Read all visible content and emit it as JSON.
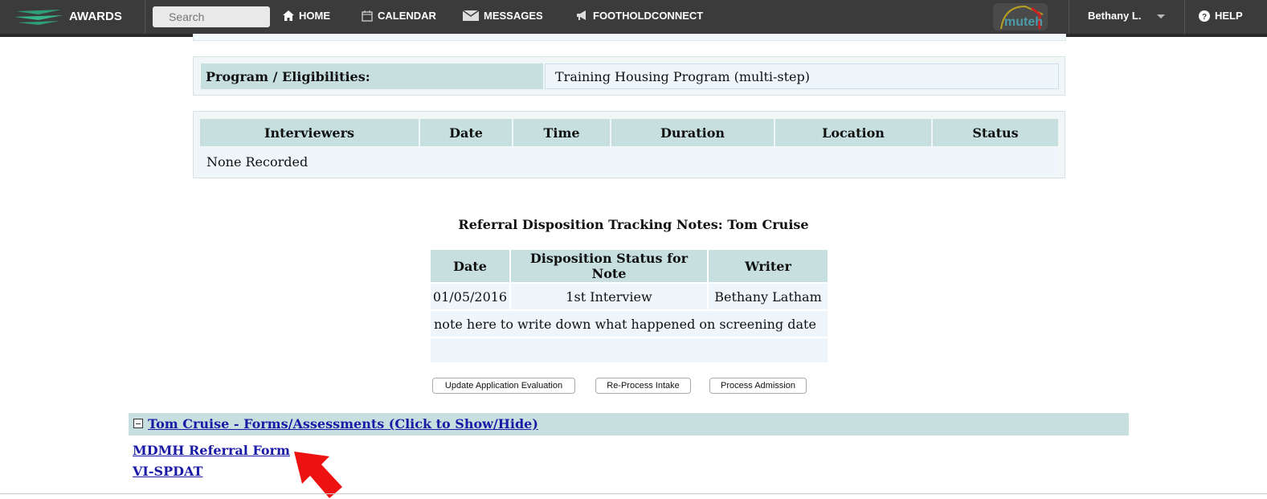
{
  "nav": {
    "brand": "AWARDS",
    "search_placeholder": "Search",
    "home": "HOME",
    "calendar": "CALENDAR",
    "messages": "MESSAGES",
    "foothold": "FOOTHOLDCONNECT",
    "partner_logo_text": "muteh",
    "user": "Bethany L.",
    "help": "HELP"
  },
  "program": {
    "label": "Program / Eligibilities:",
    "value": "Training Housing Program (multi-step)"
  },
  "interviews": {
    "headers": [
      "Interviewers",
      "Date",
      "Time",
      "Duration",
      "Location",
      "Status"
    ],
    "empty": "None Recorded"
  },
  "notes": {
    "title": "Referral Disposition Tracking Notes: Tom Cruise",
    "headers": [
      "Date",
      "Disposition Status for Note",
      "Writer"
    ],
    "row": {
      "date": "01/05/2016",
      "status": "1st Interview",
      "writer": "Bethany Latham"
    },
    "note_text": "note here to write down what happened on screening date"
  },
  "actions": {
    "update": "Update Application Evaluation",
    "reprocess": "Re-Process Intake",
    "admission": "Process Admission"
  },
  "forms": {
    "header": "Tom Cruise - Forms/Assessments (Click to Show/Hide)",
    "items": [
      "MDMH Referral Form",
      "VI-SPDAT"
    ]
  },
  "colors": {
    "nav_bg": "#3b3b3b",
    "header_cell": "#c7dfdf",
    "link": "#1a1aa6",
    "annotation_arrow": "#ee1111"
  }
}
